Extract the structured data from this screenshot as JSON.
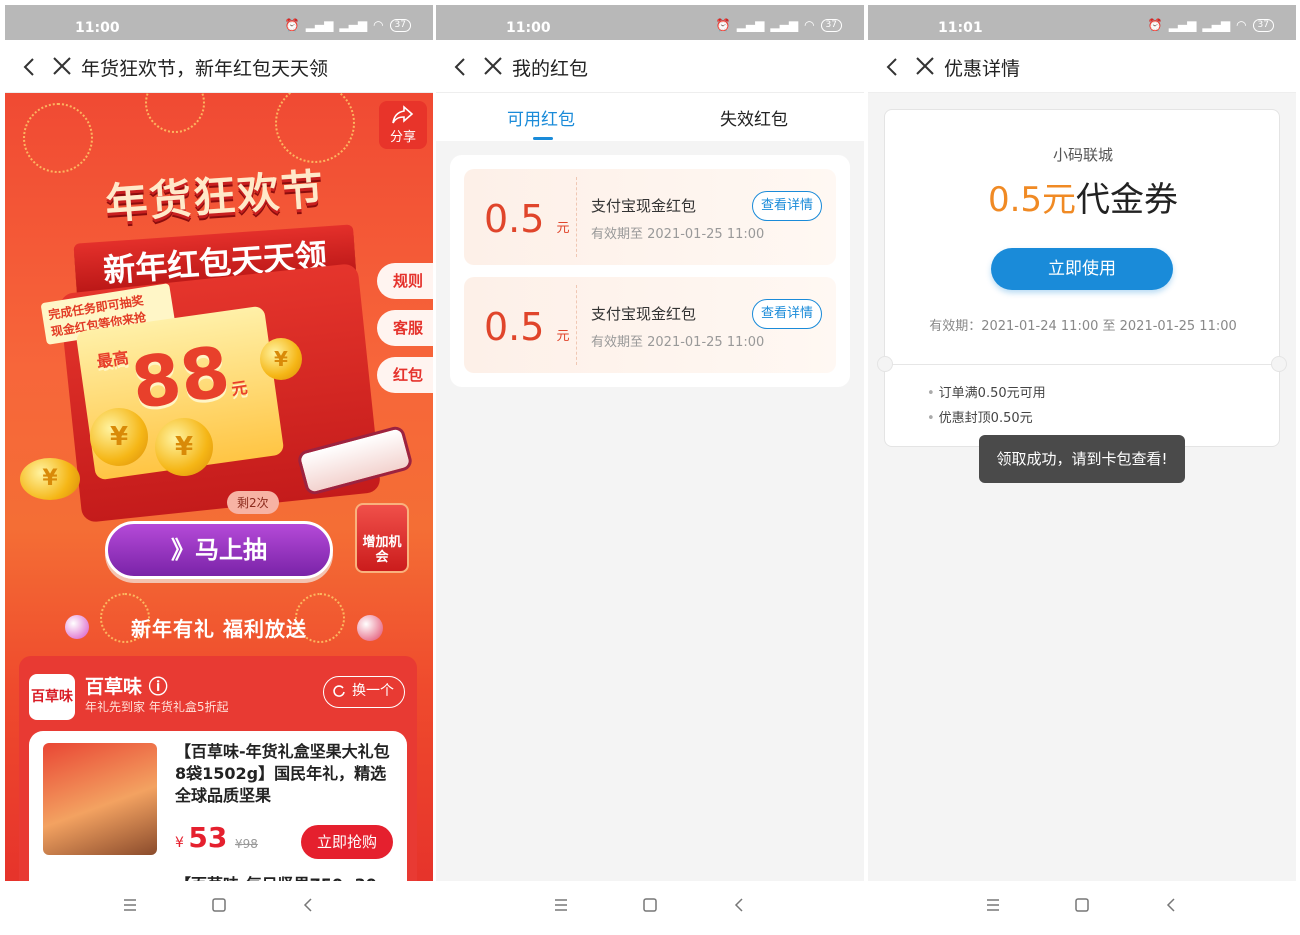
{
  "screens": [
    {
      "status_time": "11:00",
      "battery": "37",
      "title": "年货狂欢节，新年红包天天领",
      "share_label": "分享",
      "headline_1": "年货狂欢节",
      "headline_2": "新年红包天天领",
      "side_tabs": [
        "规则",
        "客服",
        "红包"
      ],
      "promo_line1": "完成任务即可抽奖",
      "promo_line2": "现金红包等你来抢",
      "max_prefix": "最高",
      "max_amount": "88",
      "max_unit": "元",
      "remaining": "剩2次",
      "draw_button": "》马上抽",
      "add_chance": "增加机会",
      "newyear_text": "新年有礼 福利放送",
      "shop": {
        "logo": "百草味",
        "name": "百草味",
        "subtitle": "年礼先到家 年货礼盒5折起",
        "swap_label": "换一个"
      },
      "product": {
        "title": "【百草味-年货礼盒坚果大礼包8袋1502g】国民年礼，精选全球品质坚果",
        "currency": "¥",
        "price": "53",
        "old_price": "¥98",
        "buy_label": "立即抢购",
        "next_title": "【百草味-每日坚果750g30"
      }
    },
    {
      "status_time": "11:00",
      "battery": "37",
      "title": "我的红包",
      "tabs": [
        "可用红包",
        "失效红包"
      ],
      "coupons": [
        {
          "amount": "0.5",
          "unit": "元",
          "name": "支付宝现金红包",
          "expiry": "有效期至 2021-01-25 11:00",
          "detail_label": "查看详情"
        },
        {
          "amount": "0.5",
          "unit": "元",
          "name": "支付宝现金红包",
          "expiry": "有效期至 2021-01-25 11:00",
          "detail_label": "查看详情"
        }
      ]
    },
    {
      "status_time": "11:01",
      "battery": "37",
      "title": "优惠详情",
      "shop_name": "小码联城",
      "voucher_amount": "0.5元",
      "voucher_label": "代金券",
      "use_button": "立即使用",
      "validity": "有效期：2021-01-24 11:00 至 2021-01-25 11:00",
      "rules": [
        "订单满0.50元可用",
        "优惠封顶0.50元"
      ],
      "toast": "领取成功，请到卡包查看!"
    }
  ],
  "colors": {
    "accent_blue": "#1a8bd9",
    "red": "#e5202e",
    "orange_amount": "#f08a24",
    "status_bar": "#b8b8b8"
  }
}
